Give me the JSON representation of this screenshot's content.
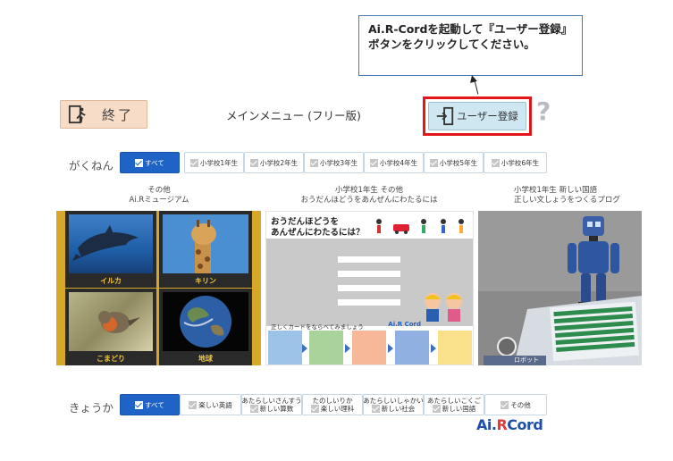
{
  "callout": {
    "text": "Ai.R-Cordを起動して『ユーザー登録』ボタンをクリックしてください。"
  },
  "header": {
    "exit_label": "終了",
    "menu_title": "メインメニュー (フリー版)",
    "register_label": "ユーザー登録",
    "help_glyph": "?"
  },
  "grade_row": {
    "label": "がくねん",
    "chips": [
      "すべて",
      "小学校1年生",
      "小学校2年生",
      "小学校3年生",
      "小学校4年生",
      "小学校5年生",
      "小学校6年生"
    ]
  },
  "cards": [
    {
      "line1": "その他",
      "line2": "Ai.Rミュージアム"
    },
    {
      "line1": "小学校1年生 その他",
      "line2": "おうだんほどうをあんぜんにわたるには"
    },
    {
      "line1": "小学校1年生 新しい国語",
      "line2": "正しい文しょうをつくるプログ"
    }
  ],
  "museum": {
    "tiles": [
      "イルカ",
      "キリン",
      "こまどり",
      "地球"
    ]
  },
  "crossing": {
    "question_l1": "おうだんほどうを",
    "question_l2": "あんぜんにわたるには？",
    "instruction": "正しくカードをならべてみましょう",
    "logo": "Ai.R Cord"
  },
  "robot": {
    "tag": "ロボット"
  },
  "subject_row": {
    "label": "きょうか",
    "chips": [
      {
        "top": "",
        "label": "すべて"
      },
      {
        "top": "",
        "label": "楽しい英語"
      },
      {
        "top": "あたらしいさんすう",
        "label": "新しい算数"
      },
      {
        "top": "たのしいりか",
        "label": "楽しい理科"
      },
      {
        "top": "あたらしいしゃかい",
        "label": "新しい社会"
      },
      {
        "top": "あたらしいこくご",
        "label": "新しい国語"
      },
      {
        "top": "",
        "label": "その他"
      }
    ]
  },
  "brand": {
    "a": "Ai.",
    "r": "R",
    "cord": "Cord"
  },
  "colors": {
    "accent": "#1f63c6",
    "highlight": "#e0161b",
    "exit_bg": "#f7dcc8",
    "register_bg": "#cfe7f1",
    "gold": "#d7a72a"
  }
}
